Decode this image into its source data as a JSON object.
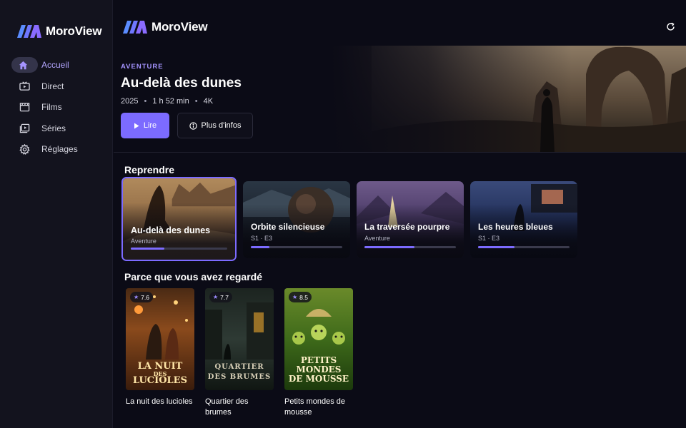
{
  "app": {
    "name": "MoroView"
  },
  "colors": {
    "accent": "#7c6bff",
    "background": "#0b0b16",
    "sidebar": "#13131e"
  },
  "sidebar": {
    "items": [
      {
        "label": "Accueil",
        "icon": "home-icon",
        "active": true
      },
      {
        "label": "Direct",
        "icon": "live-tv-icon"
      },
      {
        "label": "Films",
        "icon": "clapperboard-icon"
      },
      {
        "label": "Séries",
        "icon": "series-icon"
      },
      {
        "label": "Réglages",
        "icon": "gear-icon"
      }
    ]
  },
  "header": {
    "refresh_icon": "refresh-icon"
  },
  "hero": {
    "genre": "AVENTURE",
    "title": "Au-delà des dunes",
    "year": "2025",
    "duration": "1 h 52 min",
    "quality": "4K",
    "separator": "•",
    "play_label": "Lire",
    "info_label": "Plus d'infos"
  },
  "resume": {
    "title": "Reprendre",
    "items": [
      {
        "title": "Au-delà des dunes",
        "subtitle": "Aventure",
        "progress": 0.35
      },
      {
        "title": "Orbite silencieuse",
        "subtitle": "S1 · E3",
        "progress": 0.2
      },
      {
        "title": "La traversée pourpre",
        "subtitle": "Aventure",
        "progress": 0.55
      },
      {
        "title": "Les heures bleues",
        "subtitle": "S1 · E3",
        "progress": 0.4
      }
    ]
  },
  "recommended": {
    "title": "Parce que vous avez regardé",
    "items": [
      {
        "title": "La nuit des lucioles",
        "rating": "7.6",
        "poster_text": [
          "LA NUIT",
          "DES",
          "LUCIOLES"
        ]
      },
      {
        "title": "Quartier des brumes",
        "rating": "7.7",
        "poster_text": [
          "QUARTIER",
          "DES BRUMES"
        ]
      },
      {
        "title": "Petits mondes de mousse",
        "rating": "8.5",
        "poster_text": [
          "PETITS",
          "MONDES",
          "DE MOUSSE"
        ]
      }
    ]
  }
}
